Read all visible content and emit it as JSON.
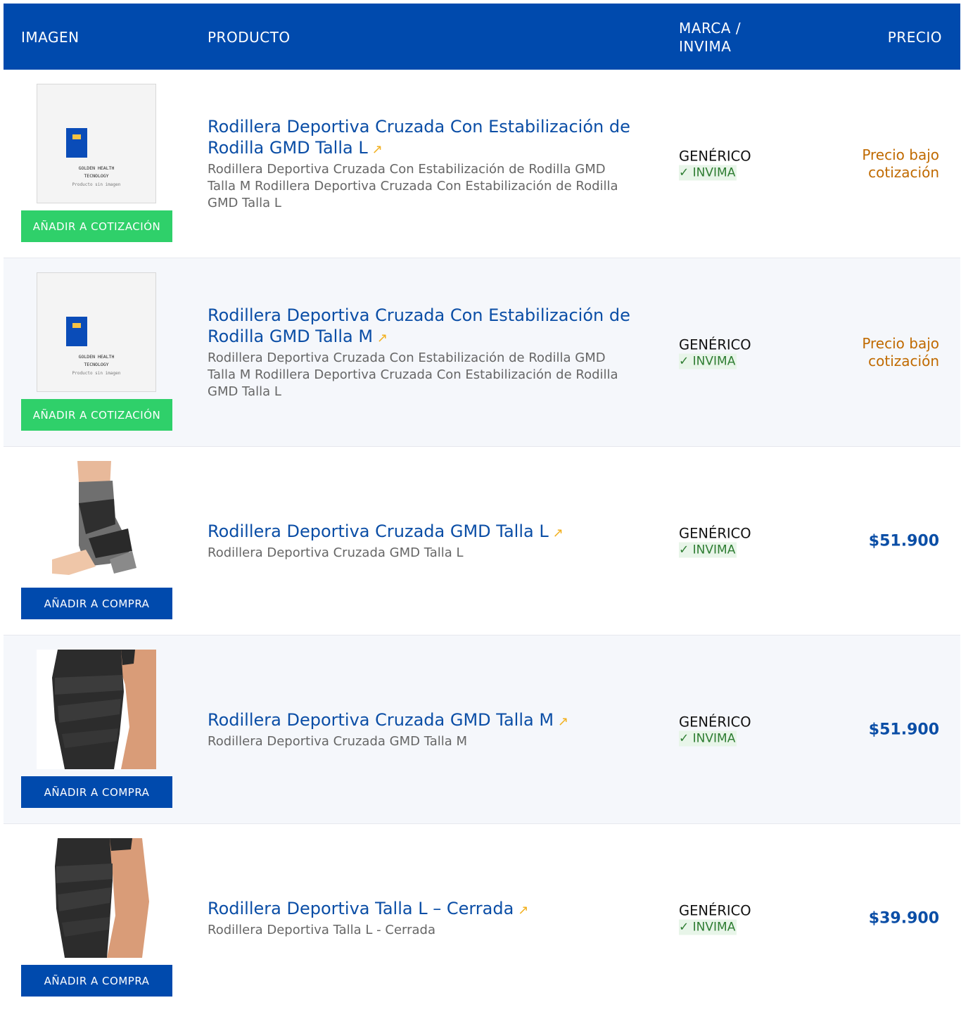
{
  "header": {
    "image": "IMAGEN",
    "product": "PRODUCTO",
    "brand": "MARCA / INVIMA",
    "price": "PRECIO"
  },
  "placeholder": {
    "brand_line1": "GOLDEN HEALTH",
    "brand_line2": "TECNOLOGY",
    "no_image": "Producto sin imagen"
  },
  "external_link_icon": "↗",
  "colors": {
    "header_bg": "#004aad",
    "quote_button": "#2fd06a",
    "buy_button": "#004aad",
    "title_link": "#0b4ea6",
    "quote_price": "#c06a00",
    "invima_text": "#2e7d32"
  },
  "rows": [
    {
      "image": "placeholder",
      "button": "AÑADIR A COTIZACIÓN",
      "title": "Rodillera Deportiva Cruzada Con Estabilización de Rodilla GMD Talla L",
      "description": "Rodillera Deportiva Cruzada Con Estabilización de Rodilla GMD Talla M Rodillera Deportiva Cruzada Con Estabilización de Rodilla GMD Talla L",
      "brand": "GENÉRICO",
      "invima": "✓ INVIMA",
      "price": "Precio bajo cotización"
    },
    {
      "image": "placeholder",
      "button": "AÑADIR A COTIZACIÓN",
      "title": "Rodillera Deportiva Cruzada Con Estabilización de Rodilla GMD Talla M",
      "description": "Rodillera Deportiva Cruzada Con Estabilización de Rodilla GMD Talla M Rodillera Deportiva Cruzada Con Estabilización de Rodilla GMD Talla L",
      "brand": "GENÉRICO",
      "invima": "✓ INVIMA",
      "price": "Precio bajo cotización"
    },
    {
      "image": "ankle-brace-photo",
      "button": "AÑADIR A COMPRA",
      "title": "Rodillera Deportiva Cruzada GMD Talla L",
      "description": "Rodillera Deportiva Cruzada GMD Talla L",
      "brand": "GENÉRICO",
      "invima": "✓ INVIMA",
      "price": "$51.900"
    },
    {
      "image": "knee-brace-photo",
      "button": "AÑADIR A COMPRA",
      "title": "Rodillera Deportiva Cruzada GMD Talla M",
      "description": "Rodillera Deportiva Cruzada GMD Talla M",
      "brand": "GENÉRICO",
      "invima": "✓ INVIMA",
      "price": "$51.900"
    },
    {
      "image": "knee-brace-photo",
      "button": "AÑADIR A COMPRA",
      "title": "Rodillera Deportiva Talla L – Cerrada",
      "description": "Rodillera Deportiva Talla L - Cerrada",
      "brand": "GENÉRICO",
      "invima": "✓ INVIMA",
      "price": "$39.900"
    }
  ]
}
